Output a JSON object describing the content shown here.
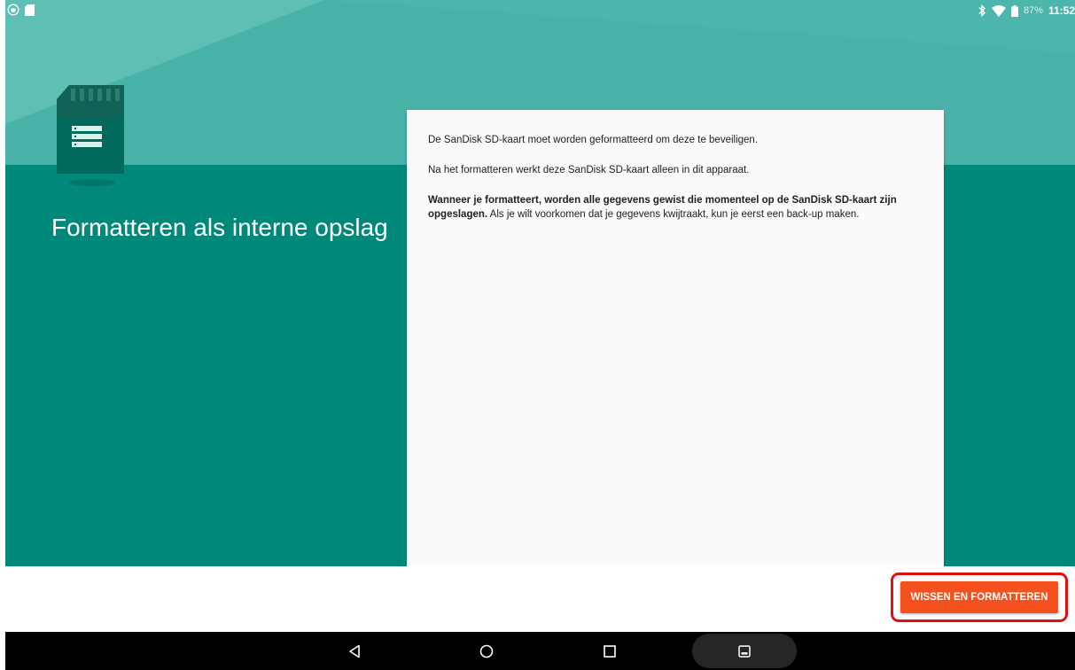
{
  "status_bar": {
    "left_icons": [
      "android-debug-icon",
      "sd-card-notification-icon"
    ],
    "right_icons": [
      "bluetooth-icon",
      "wifi-icon",
      "battery-icon"
    ],
    "battery_percent": "87%",
    "time": "11:52"
  },
  "page": {
    "title": "Formatteren als interne opslag",
    "illustration_icon": "sd-card-icon"
  },
  "card": {
    "line1": "De SanDisk SD-kaart moet worden geformatteerd om deze te beveiligen.",
    "line2": "Na het formatteren werkt deze SanDisk SD-kaart alleen in dit apparaat.",
    "warning_bold": "Wanneer je formatteert, worden alle gegevens gewist die momenteel op de SanDisk SD-kaart zijn opgeslagen.",
    "warning_rest": " Als je wilt voorkomen dat je gegevens kwijtraakt, kun je eerst een back-up maken."
  },
  "footer": {
    "action_button_label": "WISSEN EN FORMATTEREN"
  },
  "nav_bar": {
    "items": [
      "back-icon",
      "home-icon",
      "recents-icon",
      "gallery-icon"
    ]
  },
  "colors": {
    "teal_light": "#4db6ac",
    "teal_dark": "#00897b",
    "accent_orange": "#f4511e",
    "highlight_red": "#e01010"
  }
}
